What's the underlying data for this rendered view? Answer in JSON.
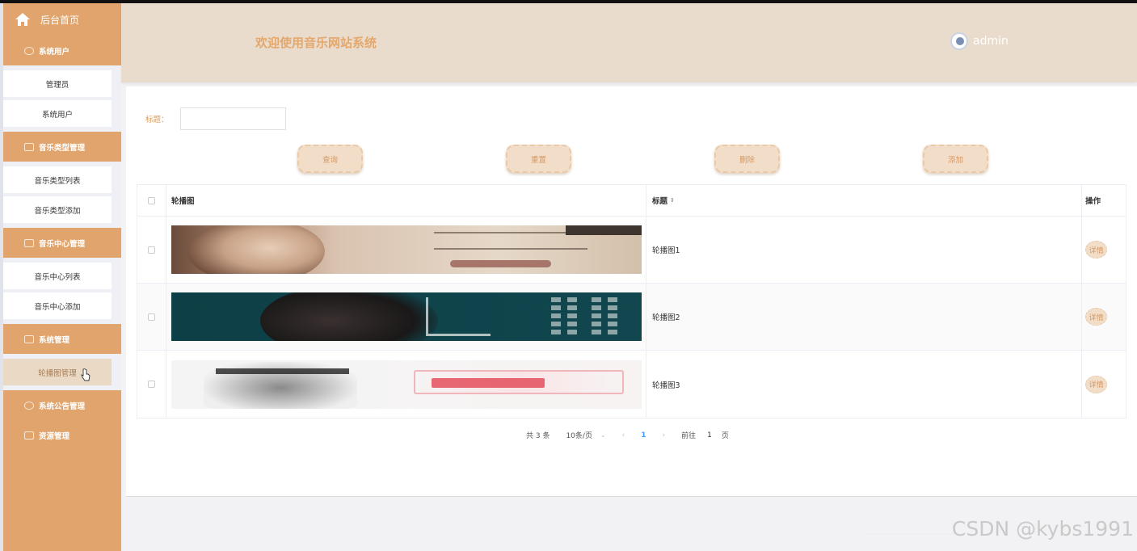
{
  "sidebar": {
    "home_label": "后台首页",
    "groups": [
      {
        "label": "系统用户",
        "items": [
          "管理员",
          "系统用户"
        ]
      },
      {
        "label": "音乐类型管理",
        "items": [
          "音乐类型列表",
          "音乐类型添加"
        ]
      },
      {
        "label": "音乐中心管理",
        "items": [
          "音乐中心列表",
          "音乐中心添加"
        ]
      },
      {
        "label": "系统管理",
        "items": [
          "轮播图管理"
        ]
      },
      {
        "label": "系统公告管理",
        "items": []
      },
      {
        "label": "资源管理",
        "items": []
      }
    ]
  },
  "header": {
    "title": "欢迎使用音乐网站系统",
    "username": "admin"
  },
  "search": {
    "title_label": "标题：",
    "title_value": "",
    "title_placeholder": ""
  },
  "buttons": {
    "query": "查询",
    "reset": "重置",
    "delete": "删除",
    "add": "添加"
  },
  "table": {
    "headers": [
      "轮播图",
      "标题",
      "操作"
    ],
    "rows": [
      {
        "title": "轮播图1",
        "action": "详情"
      },
      {
        "title": "轮播图2",
        "action": "详情"
      },
      {
        "title": "轮播图3",
        "action": "详情"
      }
    ]
  },
  "pagination": {
    "total": "共 3 条",
    "page_size": "10条/页",
    "current_page": "1",
    "goto_label": "前往",
    "goto_value": "1",
    "page_suffix": "页"
  },
  "watermark": "CSDN @kybs1991",
  "colors": {
    "sidebar_bg": "#e0a46c",
    "header_bg": "#eadccc",
    "accent": "#e4a76c"
  }
}
